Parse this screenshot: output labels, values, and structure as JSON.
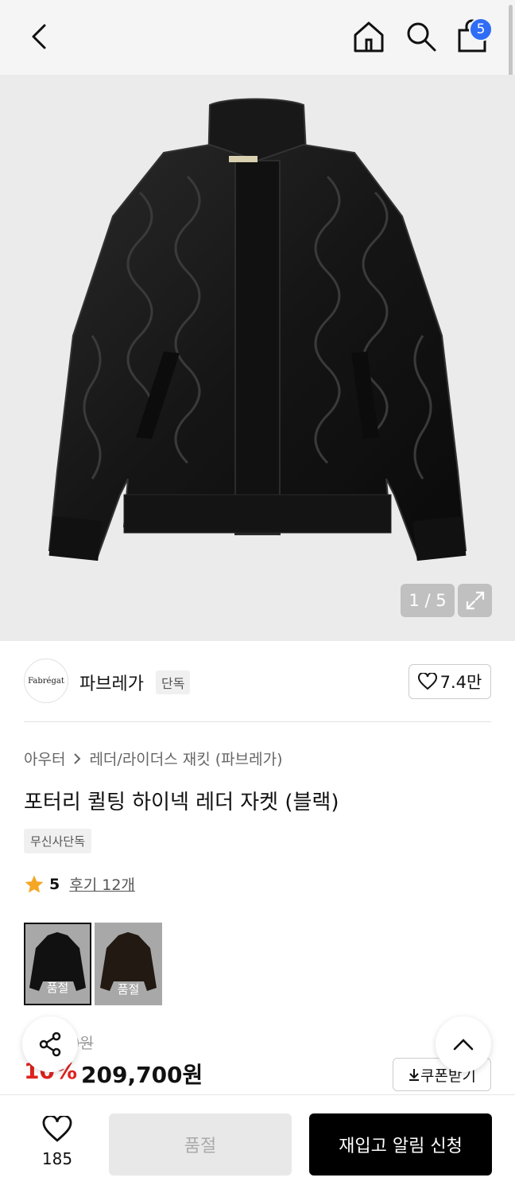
{
  "header": {
    "back_icon": "chevron-left-icon",
    "home_icon": "home-icon",
    "search_icon": "search-icon",
    "cart_icon": "shopping-bag-icon",
    "cart_count": "5",
    "badge_color": "#2f6df6"
  },
  "gallery": {
    "pager": "1 / 5",
    "expand_icon": "expand-icon"
  },
  "brand": {
    "logo_text": "Fabrégat",
    "name": "파브레가",
    "tag": "단독",
    "likes": "7.4만"
  },
  "product": {
    "breadcrumb": [
      "아우터",
      "레더/라이더스 재킷 (파브레가)"
    ],
    "title": "포터리 퀼팅 하이넥 레더 자켓 (블랙)",
    "badge": "무신사단독",
    "rating": "5",
    "reviews": "후기 12개",
    "variants": [
      {
        "label": "품절",
        "selected": true
      },
      {
        "label": "품절",
        "selected": false
      }
    ],
    "original_price": "0원",
    "discount": "10%",
    "price": "209,700원",
    "coupon_button": "쿠폰받기"
  },
  "bottom_bar": {
    "wish_count": "185",
    "soldout_label": "품절",
    "restock_label": "재입고 알림 신청"
  },
  "colors": {
    "accent_red": "#e0221d",
    "star": "#f5a623"
  }
}
